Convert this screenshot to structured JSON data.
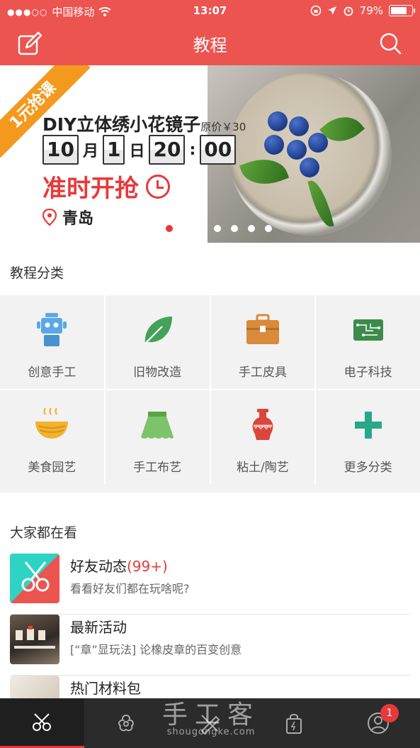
{
  "status_bar": {
    "carrier": "中国移动",
    "time": "13:07",
    "battery": "79%",
    "battery_level": 0.79
  },
  "header": {
    "title": "教程",
    "edit_icon": "edit-icon",
    "search_icon": "search-icon"
  },
  "banner": {
    "ribbon": "1元抢课",
    "title": "DIY立体绣小花镜子",
    "original_price": "原价￥30",
    "month": "10",
    "month_unit": "月",
    "day": "1",
    "day_unit": "日",
    "hour": "20",
    "colon": ":",
    "minute": "00",
    "cta": "准时开抢",
    "location": "青岛",
    "page_count": 5,
    "active_page": 0
  },
  "categories": {
    "title": "教程分类",
    "items": [
      {
        "label": "创意手工",
        "icon": "robot-icon",
        "color": "#5aa9e6"
      },
      {
        "label": "旧物改造",
        "icon": "leaf-icon",
        "color": "#44a158"
      },
      {
        "label": "手工皮具",
        "icon": "briefcase-icon",
        "color": "#d98a3a"
      },
      {
        "label": "电子科技",
        "icon": "circuit-icon",
        "color": "#3c8b4a"
      },
      {
        "label": "美食园艺",
        "icon": "food-bowl-icon",
        "color": "#f2b22e"
      },
      {
        "label": "手工布艺",
        "icon": "skirt-icon",
        "color": "#7cc36a"
      },
      {
        "label": "粘土/陶艺",
        "icon": "vase-icon",
        "color": "#d9463c"
      },
      {
        "label": "更多分类",
        "icon": "plus-icon",
        "color": "#27a889"
      }
    ]
  },
  "popular": {
    "title": "大家都在看",
    "items": [
      {
        "title": "好友动态",
        "count": "(99+)",
        "subtitle": "看看好友们都在玩啥呢?"
      },
      {
        "title": "最新活动",
        "count": "",
        "subtitle": "[“章”显玩法] 论橡皮章的百变创意"
      },
      {
        "title": "热门材料包",
        "count": "",
        "subtitle": ""
      }
    ]
  },
  "tabbar": {
    "tabs": [
      {
        "name": "scissors-icon"
      },
      {
        "name": "flower-icon"
      },
      {
        "name": "pencil-ruler-icon"
      },
      {
        "name": "shopping-bag-icon"
      },
      {
        "name": "user-icon"
      }
    ],
    "badge": "1",
    "watermark": "手工客",
    "watermark_url": "shougongke.com"
  },
  "colors": {
    "primary": "#ec5450",
    "accent": "#e8393a",
    "ribbon": "#f39a1e",
    "tabbar": "#2b2b2b"
  }
}
